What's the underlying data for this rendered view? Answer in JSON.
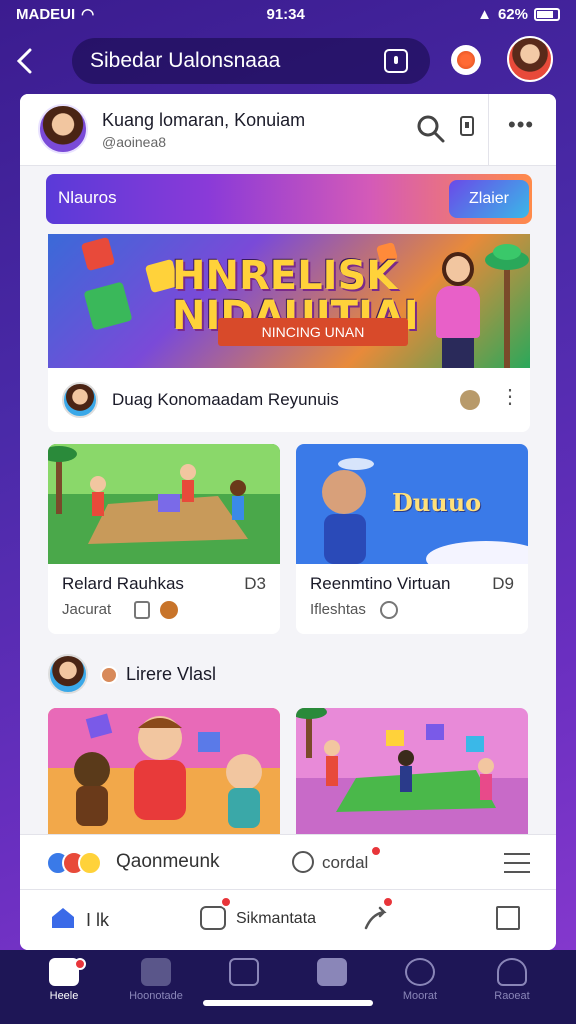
{
  "status_bar": {
    "carrier": "MADEUI",
    "time": "91:34",
    "battery": "62%"
  },
  "nav": {
    "title": "Sibedar Ualonsnaaa"
  },
  "header": {
    "title": "Kuang lomaran, Konuiam",
    "subtitle": "@aoinea8"
  },
  "banner": {
    "tab_left": "Nlauros",
    "tab_right": "Zlaier",
    "hero_title": "HNRELISK NIDAUITIAI",
    "hero_ribbon": "NINCING UNAN"
  },
  "featured_post": {
    "title": "Duag Konomaadam Reyunuis"
  },
  "grid_cards": [
    {
      "title": "Relard Rauhkas",
      "subtitle": "Jacurat",
      "count": "D3"
    },
    {
      "title": "Reenmtino Virtuan",
      "subtitle": "Ifleshtas",
      "count": "D9",
      "image_text": "Duuuo"
    }
  ],
  "section": {
    "title": "Lirere Vlasl"
  },
  "action_bar": {
    "reactions_label": "Qaonmeunk",
    "comments_label": "cordal"
  },
  "action_bar2": {
    "home_label": "I lk",
    "messages_label": "Sikmantata"
  },
  "bottom_nav": [
    {
      "label": "Heele",
      "active": true
    },
    {
      "label": "Hoonotade",
      "active": false
    },
    {
      "label": "",
      "active": false
    },
    {
      "label": "",
      "active": false
    },
    {
      "label": "Moorat",
      "active": false
    },
    {
      "label": "Raoeat",
      "active": false
    }
  ],
  "colors": {
    "accent": "#4a2aa8",
    "badge": "#e8353a",
    "nav_bg": "#1e1656"
  }
}
